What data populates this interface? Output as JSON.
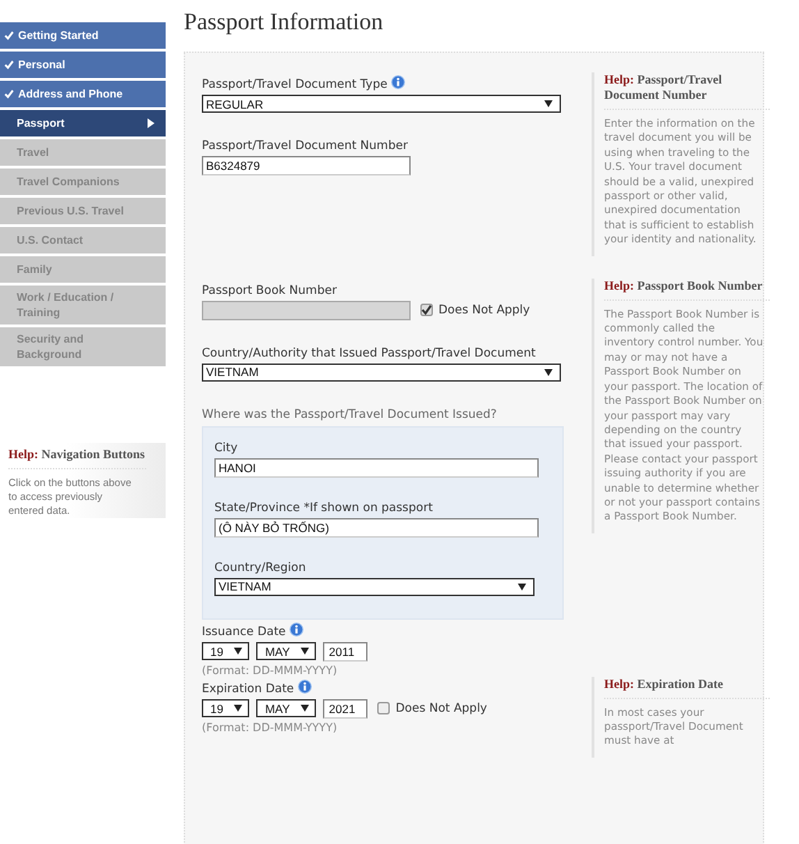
{
  "title": "Passport Information",
  "nav": [
    {
      "label": "Getting Started",
      "completed": true,
      "selected": false
    },
    {
      "label": "Personal",
      "completed": true,
      "selected": false
    },
    {
      "label": "Address and Phone",
      "completed": true,
      "selected": false
    },
    {
      "label": "Passport",
      "completed": false,
      "selected": true
    },
    {
      "label": "Travel",
      "completed": false,
      "selected": false
    },
    {
      "label": "Travel Companions",
      "completed": false,
      "selected": false
    },
    {
      "label": "Previous U.S. Travel",
      "completed": false,
      "selected": false
    },
    {
      "label": "U.S. Contact",
      "completed": false,
      "selected": false
    },
    {
      "label": "Family",
      "completed": false,
      "selected": false
    },
    {
      "label": "Work / Education / Training",
      "completed": false,
      "selected": false
    },
    {
      "label": "Security and Background",
      "completed": false,
      "selected": false
    }
  ],
  "nav_help": {
    "prefix": "Help:",
    "title": "Navigation Buttons",
    "text": "Click on the buttons above to access previously entered data."
  },
  "sections": [
    {
      "fields": [
        {
          "kind": "select",
          "label": "Passport/Travel Document Type",
          "info": true,
          "value": "REGULAR"
        },
        {
          "kind": "text",
          "label": "Passport/Travel Document Number",
          "value": "B6324879"
        }
      ],
      "help": {
        "prefix": "Help:",
        "title": "Passport/Travel Document Number",
        "text": "Enter the information on the travel document you will be using when traveling to the U.S. Your travel document should be a valid, unexpired passport or other valid, unexpired documentation that is sufficient to establish your identity and nationality."
      }
    },
    {
      "fields": [
        {
          "kind": "text",
          "label": "Passport Book Number",
          "disabled": true,
          "na": {
            "label": "Does Not Apply",
            "checked": true
          }
        },
        {
          "kind": "select",
          "label": "Country/Authority that Issued Passport/Travel Document",
          "value": "VIETNAM"
        },
        {
          "kind": "group",
          "label": "Where was the Passport/Travel Document Issued?",
          "children": [
            {
              "kind": "text",
              "label": "City",
              "value": "HANOI"
            },
            {
              "kind": "text",
              "label": "State/Province *If shown on passport",
              "value": "(Ô NÀY BỎ TRỐNG)"
            },
            {
              "kind": "select",
              "label": "Country/Region",
              "value": "VIETNAM"
            }
          ]
        }
      ],
      "help": {
        "prefix": "Help:",
        "title": "Passport Book Number",
        "text": "The Passport Book Number is commonly called the inventory control number. You may or may not have a Passport Book Number on your passport. The location of the Passport Book Number on your passport may vary depending on the country that issued your passport. Please contact your passport issuing authority if you are unable to determine whether or not your passport contains a Passport Book Number."
      }
    },
    {
      "fields": [
        {
          "kind": "date",
          "label": "Issuance Date",
          "info": true,
          "day": "19",
          "month": "MAY",
          "year": "2011",
          "format": "(Format: DD-MMM-YYYY)"
        }
      ]
    },
    {
      "fields": [
        {
          "kind": "date",
          "label": "Expiration Date",
          "info": true,
          "day": "19",
          "month": "MAY",
          "year": "2021",
          "format": "(Format: DD-MMM-YYYY)",
          "na": {
            "label": "Does Not Apply",
            "checked": false
          }
        }
      ],
      "help": {
        "prefix": "Help:",
        "title": "Expiration Date",
        "text": "In most cases your passport/Travel Document must have at"
      }
    }
  ]
}
